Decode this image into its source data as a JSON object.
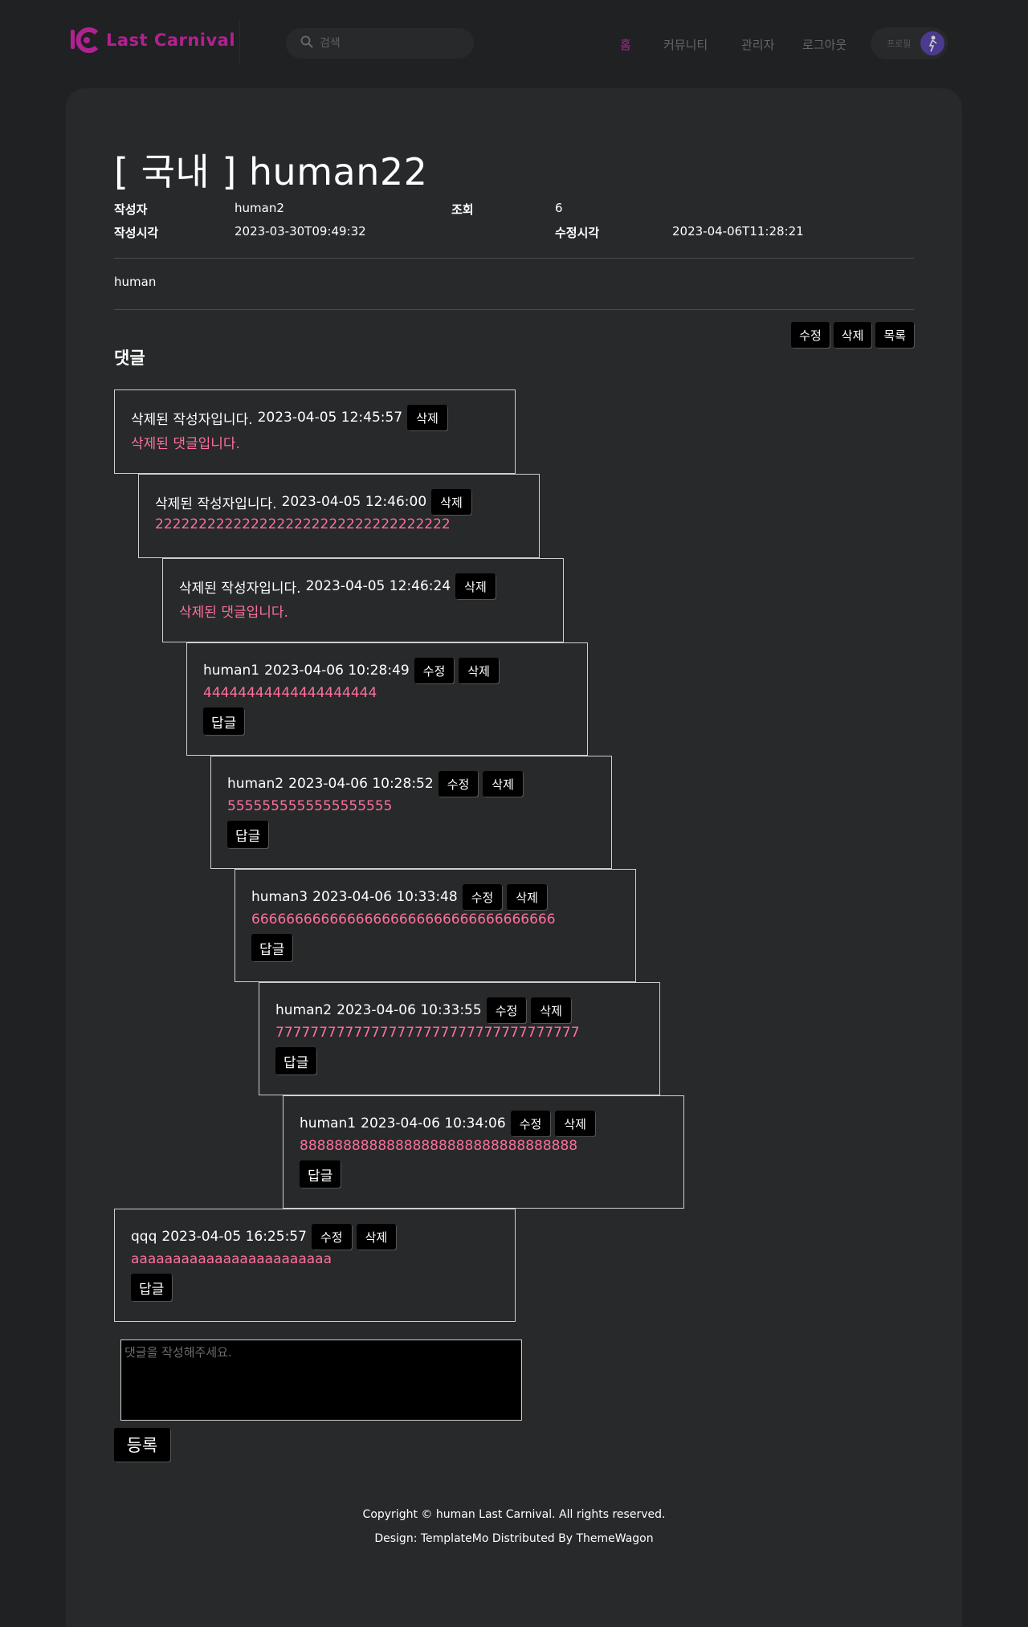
{
  "header": {
    "logo_text": "Last Carnival",
    "search_placeholder": "검색",
    "nav": [
      "홈",
      "커뮤니티",
      "관리자",
      "로그아웃"
    ],
    "profile_label": "프로필"
  },
  "post": {
    "title": "[ 국내 ] human22",
    "author_label": "작성자",
    "author": "human2",
    "views_label": "조회",
    "views": "6",
    "created_label": "작성시각",
    "created": "2023-03-30T09:49:32",
    "modified_label": "수정시각",
    "modified": "2023-04-06T11:28:21",
    "body": "human",
    "edit_label": "수정",
    "delete_label": "삭제",
    "list_label": "목록"
  },
  "comments_title": "댓글",
  "comments": [
    {
      "author": "삭제된 작성자입니다.",
      "time": "2023-04-05 12:45:57",
      "text": "삭제된 댓글입니다.",
      "can_edit": false,
      "can_reply": false
    },
    {
      "author": "삭제된 작성자입니다.",
      "time": "2023-04-05 12:46:00",
      "text": "2222222222222222222222222222222222",
      "can_edit": false,
      "can_reply": false
    },
    {
      "author": "삭제된 작성자입니다.",
      "time": "2023-04-05 12:46:24",
      "text": "삭제된 댓글입니다.",
      "can_edit": false,
      "can_reply": false
    },
    {
      "author": "human1",
      "time": "2023-04-06 10:28:49",
      "text": "44444444444444444444",
      "can_edit": true,
      "can_reply": true
    },
    {
      "author": "human2",
      "time": "2023-04-06 10:28:52",
      "text": "5555555555555555555",
      "can_edit": true,
      "can_reply": true
    },
    {
      "author": "human3",
      "time": "2023-04-06 10:33:48",
      "text": "66666666666666666666666666666666666",
      "can_edit": true,
      "can_reply": true
    },
    {
      "author": "human2",
      "time": "2023-04-06 10:33:55",
      "text": "77777777777777777777777777777777777",
      "can_edit": true,
      "can_reply": true
    },
    {
      "author": "human1",
      "time": "2023-04-06 10:34:06",
      "text": "88888888888888888888888888888888",
      "can_edit": true,
      "can_reply": true
    },
    {
      "author": "qqq",
      "time": "2023-04-05 16:25:57",
      "text": "aaaaaaaaaaaaaaaaaaaaaaaa",
      "can_edit": true,
      "can_reply": true
    }
  ],
  "comment_labels": {
    "edit": "수정",
    "delete": "삭제",
    "reply": "답글"
  },
  "comment_form": {
    "placeholder": "댓글을 작성해주세요.",
    "submit": "등록"
  },
  "footer": {
    "copyright": "Copyright © human Last Carnival. All rights reserved.",
    "design": "Design: TemplateMo Distributed By ThemeWagon"
  },
  "colors": {
    "accent": "#b0228f",
    "comment_text": "#ff6f9d",
    "background": "#1f2122",
    "card": "#27292a"
  }
}
